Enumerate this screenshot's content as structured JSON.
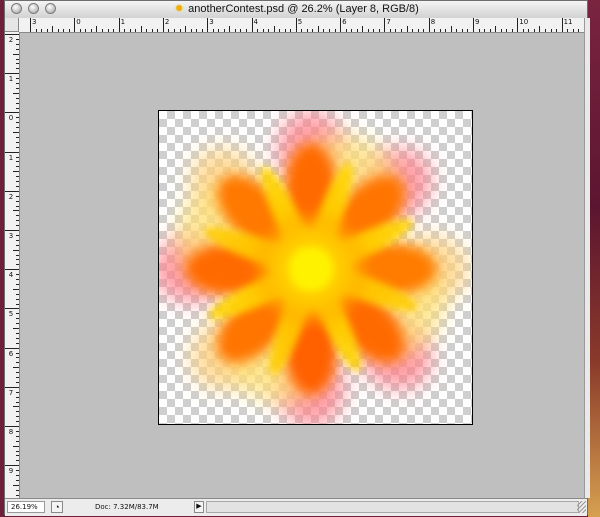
{
  "window": {
    "title": "anotherContest.psd @ 26.2% (Layer 8, RGB/8)",
    "title_icon": "photoshop-document-icon"
  },
  "rulers": {
    "top_labels": [
      "3",
      "0",
      "1",
      "2",
      "3",
      "4",
      "5",
      "6",
      "7",
      "8",
      "9",
      "10",
      "11"
    ],
    "left_labels": [
      "2",
      "1",
      "0",
      "1",
      "2",
      "3",
      "4",
      "5",
      "6",
      "7",
      "8",
      "9"
    ]
  },
  "status": {
    "zoom": "26.19%",
    "doc_info": "Doc: 7.32M/83.7M"
  },
  "colors": {
    "canvas_background": "#c0c0c0",
    "flower_outer": "#ff8a8a",
    "flower_petals": "#ff7a00",
    "flower_center": "#ffe600"
  }
}
